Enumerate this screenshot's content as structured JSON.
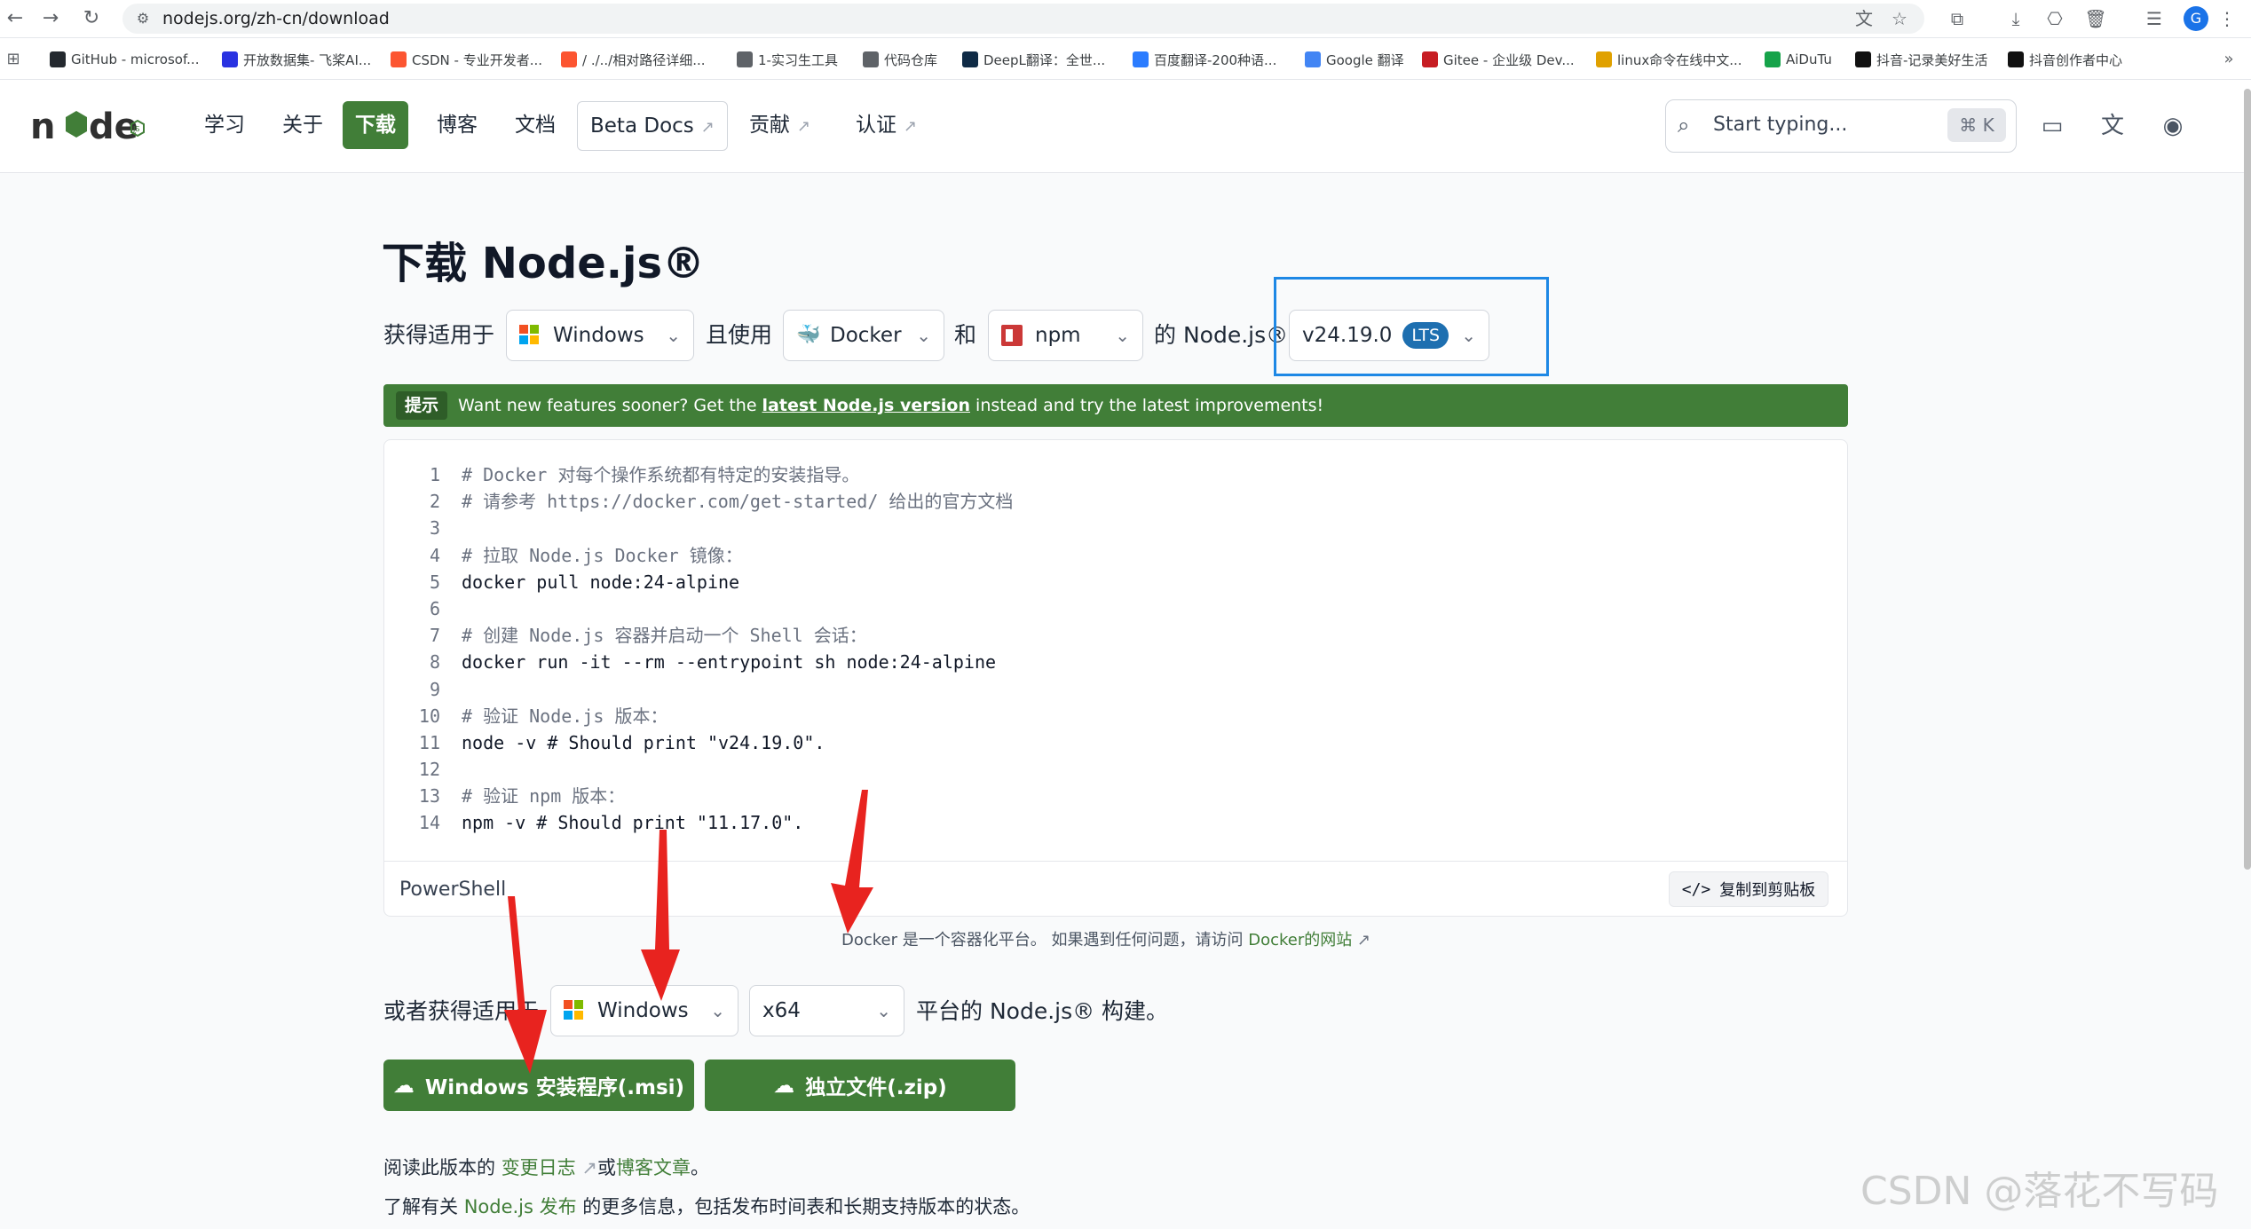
{
  "browser": {
    "url": "nodejs.org/zh-cn/download",
    "bookmarks": [
      {
        "label": "GitHub - microsof...",
        "icon": "github-icon",
        "color": "#24292f"
      },
      {
        "label": "开放数据集- 飞桨AI...",
        "icon": "paddle-icon",
        "color": "#2932e1"
      },
      {
        "label": "CSDN - 专业开发者...",
        "icon": "csdn-icon",
        "color": "#fc5531"
      },
      {
        "label": "/ ./../相对路径详细...",
        "icon": "csdn-icon",
        "color": "#fc5531"
      },
      {
        "label": "1-实习生工具",
        "icon": "folder-icon",
        "color": "#5f6368"
      },
      {
        "label": "代码仓库",
        "icon": "folder-icon",
        "color": "#5f6368"
      },
      {
        "label": "DeepL翻译：全世...",
        "icon": "deepl-icon",
        "color": "#0f2b46"
      },
      {
        "label": "百度翻译-200种语...",
        "icon": "baidu-translate-icon",
        "color": "#2b7cff"
      },
      {
        "label": "Google 翻译",
        "icon": "google-translate-icon",
        "color": "#4285f4"
      },
      {
        "label": "Gitee - 企业级 Dev...",
        "icon": "gitee-icon",
        "color": "#c71d23"
      },
      {
        "label": "linux命令在线中文...",
        "icon": "linux-icon",
        "color": "#e0a100"
      },
      {
        "label": "AiDuTu",
        "icon": "aidutu-icon",
        "color": "#16a34a"
      },
      {
        "label": "抖音-记录美好生活",
        "icon": "douyin-icon",
        "color": "#111111"
      },
      {
        "label": "抖音创作者中心",
        "icon": "douyin-icon",
        "color": "#111111"
      }
    ]
  },
  "header": {
    "nav": [
      {
        "label": "学习",
        "external": false,
        "active": false
      },
      {
        "label": "关于",
        "external": false,
        "active": false
      },
      {
        "label": "下载",
        "external": false,
        "active": true
      },
      {
        "label": "博客",
        "external": false,
        "active": false
      },
      {
        "label": "文档",
        "external": false,
        "active": false
      },
      {
        "label": "Beta Docs",
        "external": true,
        "active": false
      },
      {
        "label": "贡献",
        "external": true,
        "active": false
      },
      {
        "label": "认证",
        "external": true,
        "active": false
      }
    ],
    "search_placeholder": "Start typing...",
    "search_shortcut": "⌘ K",
    "external_arrow": "↗"
  },
  "main": {
    "title": "下载 Node.js®",
    "selector": {
      "prefix": "获得适用于",
      "os": "Windows",
      "connector_use": "且使用",
      "tool": "Docker",
      "connector_and": "和",
      "package_manager": "npm",
      "suffix": "的 Node.js®",
      "version": "v24.19.0",
      "version_badge": "LTS"
    },
    "banner": {
      "tag": "提示",
      "text_before": "Want new features sooner? Get the ",
      "link": "latest Node.js version",
      "text_after": " instead and try the latest improvements!"
    },
    "code": {
      "lines": [
        {
          "n": "1",
          "text": "# Docker 对每个操作系统都有特定的安装指导。",
          "comment": true
        },
        {
          "n": "2",
          "text": "# 请参考 https://docker.com/get-started/ 给出的官方文档",
          "comment": true
        },
        {
          "n": "3",
          "text": "",
          "comment": false
        },
        {
          "n": "4",
          "text": "# 拉取 Node.js Docker 镜像：",
          "comment": true
        },
        {
          "n": "5",
          "text": "docker pull node:24-alpine",
          "comment": false
        },
        {
          "n": "6",
          "text": "",
          "comment": false
        },
        {
          "n": "7",
          "text": "# 创建 Node.js 容器并启动一个 Shell 会话：",
          "comment": true
        },
        {
          "n": "8",
          "text": "docker run -it --rm --entrypoint sh node:24-alpine",
          "comment": false
        },
        {
          "n": "9",
          "text": "",
          "comment": false
        },
        {
          "n": "10",
          "text": "# 验证 Node.js 版本：",
          "comment": true
        },
        {
          "n": "11",
          "text": "node -v # Should print \"v24.19.0\".",
          "comment": false
        },
        {
          "n": "12",
          "text": "",
          "comment": false
        },
        {
          "n": "13",
          "text": "# 验证 npm 版本：",
          "comment": true
        },
        {
          "n": "14",
          "text": "npm -v # Should print \"11.17.0\".",
          "comment": false
        }
      ],
      "language": "PowerShell",
      "copy_label": "复制到剪贴板"
    },
    "docker_note": {
      "text": "Docker 是一个容器化平台。 如果遇到任何问题，请访问 ",
      "link": "Docker的网站",
      "arrow": "↗"
    },
    "prebuilt": {
      "prefix": "或者获得适用于",
      "os": "Windows",
      "arch": "x64",
      "suffix": "平台的 Node.js® 构建。",
      "msi_button": "Windows 安装程序(.msi)",
      "zip_button": "独立文件(.zip)"
    },
    "footer": {
      "line1_before": "阅读此版本的 ",
      "line1_link1": "变更日志",
      "line1_arrow": "↗",
      "line1_mid": "或",
      "line1_link2": "博客文章",
      "line1_after": "。",
      "line2_before": "了解有关 ",
      "line2_link": "Node.js 发布",
      "line2_after": " 的更多信息，包括发布时间表和长期支持版本的状态。"
    }
  },
  "watermark": "CSDN @落花不写码",
  "colors": {
    "brand_green": "#417e38",
    "highlight_blue": "#1e88e5",
    "annotation_red": "#e8231f"
  }
}
